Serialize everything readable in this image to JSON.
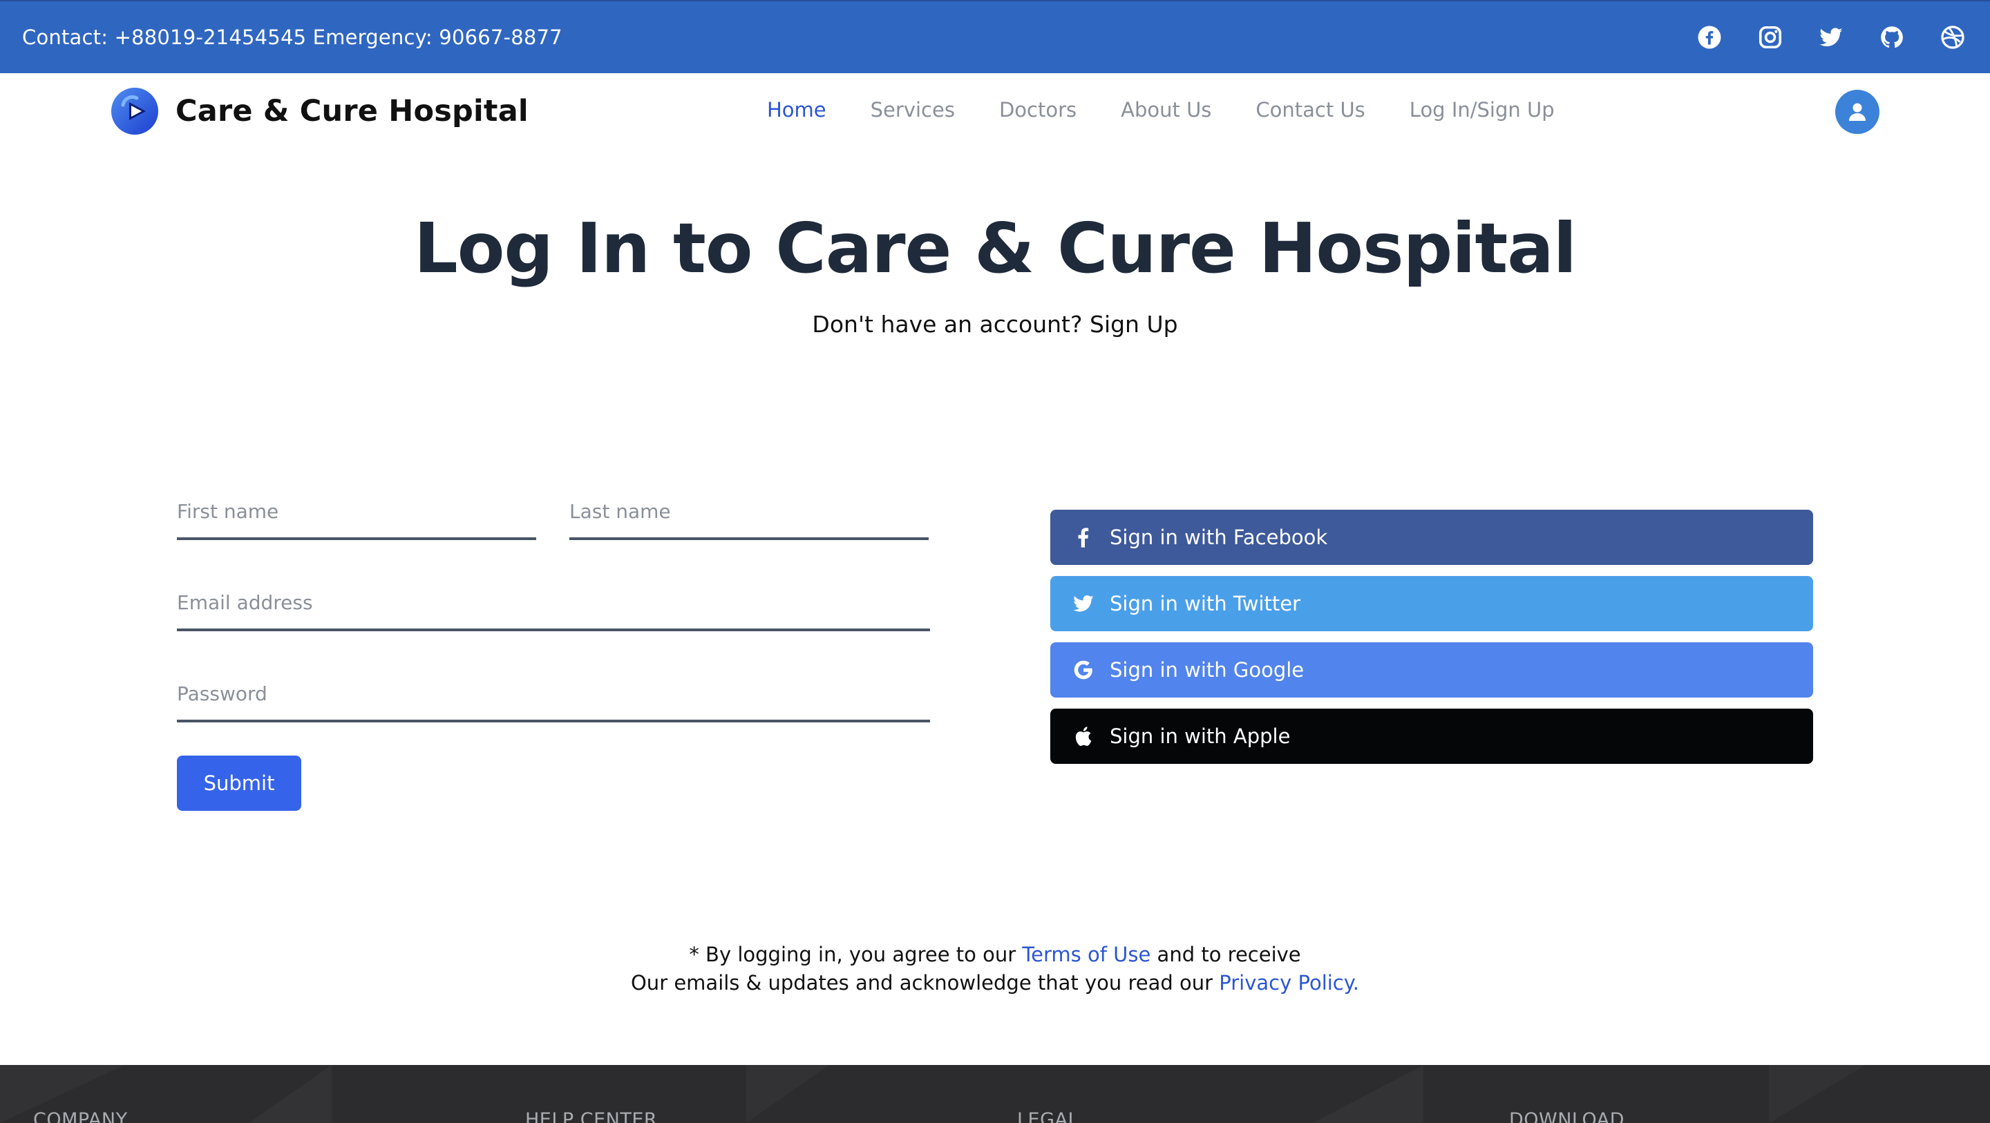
{
  "topbar": {
    "contact": "Contact: +88019-21454545 Emergency: 90667-8877",
    "socials": [
      "facebook-icon",
      "instagram-icon",
      "twitter-icon",
      "github-icon",
      "dribbble-icon"
    ]
  },
  "brand": {
    "name": "Care & Cure Hospital"
  },
  "nav": {
    "items": [
      "Home",
      "Services",
      "Doctors",
      "About Us",
      "Contact Us",
      "Log In/Sign Up"
    ],
    "active": "Home"
  },
  "heading": {
    "title": "Log In to Care & Cure Hospital",
    "subtitle": "Don't have an account? Sign Up"
  },
  "form": {
    "first_name": {
      "placeholder": "First name",
      "value": ""
    },
    "last_name": {
      "placeholder": "Last name",
      "value": ""
    },
    "email": {
      "placeholder": "Email address",
      "value": ""
    },
    "password": {
      "placeholder": "Password",
      "value": ""
    },
    "submit": "Submit"
  },
  "social_signin": {
    "facebook": "Sign in with Facebook",
    "twitter": "Sign in with Twitter",
    "google": "Sign in with Google",
    "apple": "Sign in with Apple"
  },
  "disclaimer": {
    "line1_pre": "* By logging in, you agree to our ",
    "terms": "Terms of Use",
    "line1_post": " and to receive",
    "line2_pre": "Our emails & updates and acknowledge that you read our ",
    "privacy": "Privacy Policy."
  },
  "footer": {
    "columns": [
      "COMPANY",
      "HELP CENTER",
      "LEGAL",
      "DOWNLOAD"
    ]
  },
  "colors": {
    "topbar": "#2f66c0",
    "accent": "#3563e9",
    "facebook": "#3e5a9a",
    "twitter": "#4a9fe9",
    "google": "#5184ec",
    "apple": "#050608",
    "footer": "#2c2c2e"
  }
}
